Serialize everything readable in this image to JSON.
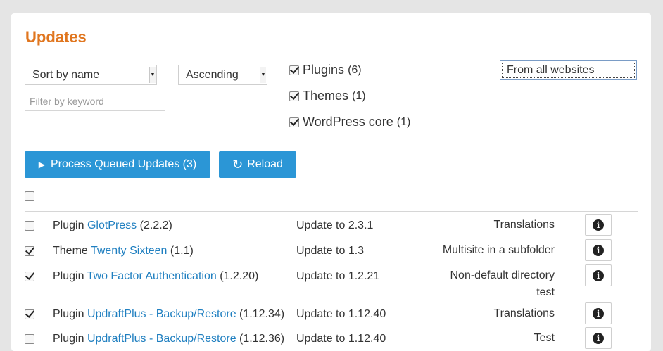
{
  "title": "Updates",
  "sort": {
    "selected": "Sort by name"
  },
  "order": {
    "selected": "Ascending"
  },
  "filter": {
    "placeholder": "Filter by keyword",
    "value": ""
  },
  "types": [
    {
      "label": "Plugins",
      "count": "(6)",
      "checked": true
    },
    {
      "label": "Themes",
      "count": "(1)",
      "checked": true
    },
    {
      "label": "WordPress core",
      "count": "(1)",
      "checked": true
    }
  ],
  "websites": {
    "selected": "From all websites"
  },
  "buttons": {
    "process_label": "Process Queued Updates (3)",
    "reload_label": "Reload"
  },
  "rows": [
    {
      "type": "Plugin",
      "name": "GlotPress",
      "version": "(2.2.2)",
      "update": "Update to 2.3.1",
      "site_lines": [
        "Translations"
      ],
      "checked": false
    },
    {
      "type": "Theme",
      "name": "Twenty Sixteen",
      "version": "(1.1)",
      "update": "Update to 1.3",
      "site_lines": [
        "Multisite in a subfolder"
      ],
      "checked": true
    },
    {
      "type": "Plugin",
      "name": "Two Factor Authentication",
      "version": "(1.2.20)",
      "update": "Update to 1.2.21",
      "site_lines": [
        "Non-default directory",
        "test"
      ],
      "checked": true
    },
    {
      "type": "Plugin",
      "name": "UpdraftPlus - Backup/Restore",
      "version": "(1.12.34)",
      "update": "Update to 1.12.40",
      "site_lines": [
        "Translations"
      ],
      "checked": true
    },
    {
      "type": "Plugin",
      "name": "UpdraftPlus - Backup/Restore",
      "version": "(1.12.36)",
      "update": "Update to 1.12.40",
      "site_lines": [
        "Test"
      ],
      "checked": false
    }
  ],
  "info_icon": "info-circle-icon",
  "colors": {
    "title": "#e0761f",
    "button": "#2b96d6",
    "link": "#1f7fc0"
  }
}
